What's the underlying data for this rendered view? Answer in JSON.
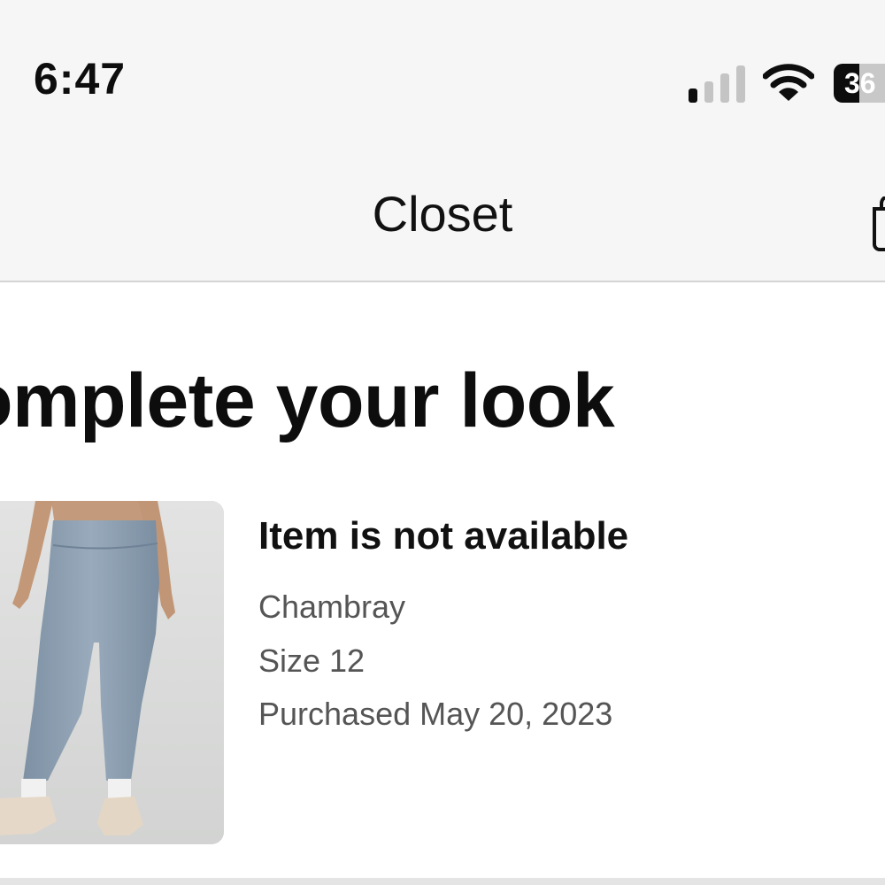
{
  "status_bar": {
    "time": "6:47",
    "battery_level_text": "36",
    "battery_percent": 36,
    "icons": [
      "cellular-signal-icon",
      "wifi-icon",
      "battery-icon"
    ]
  },
  "nav": {
    "title": "Closet",
    "right_icon": "shopping-bag-icon"
  },
  "section": {
    "title": "omplete your look"
  },
  "product": {
    "status": "Item is not available",
    "color": "Chambray",
    "size": "Size 12",
    "purchased": "Purchased May 20, 2023",
    "image_icon": "leggings-product-image"
  },
  "colors": {
    "background": "#ffffff",
    "top_bar": "#f6f6f6",
    "text_primary": "#111111",
    "text_secondary": "#555555",
    "leggings": "#8a9daf"
  }
}
